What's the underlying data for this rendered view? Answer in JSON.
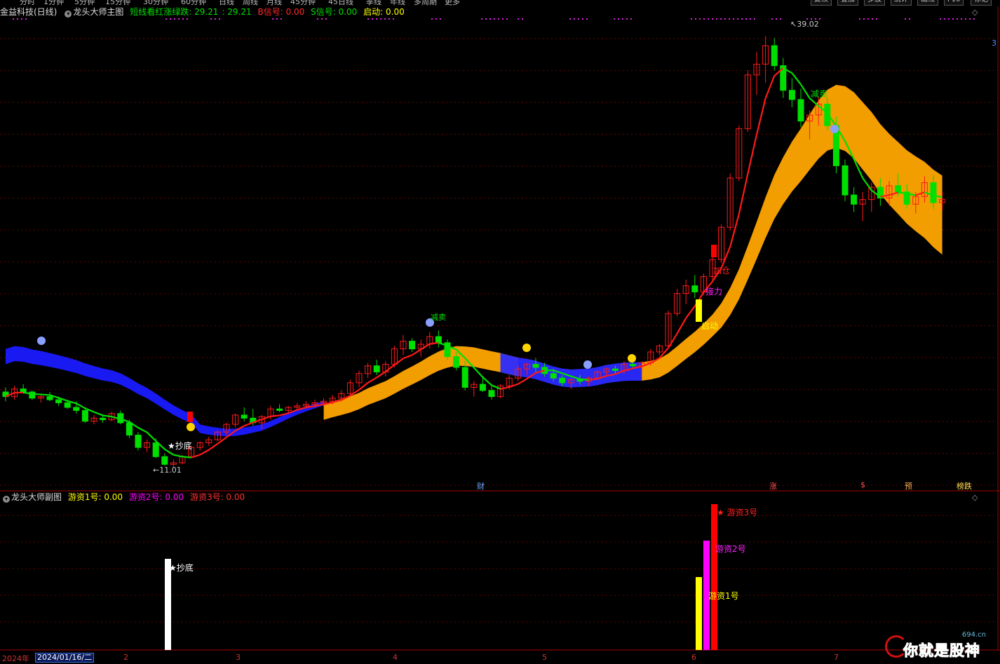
{
  "toolbar": {
    "periods": [
      "分时",
      "1分钟",
      "5分钟",
      "15分钟",
      "30分钟",
      "60分钟",
      "日线",
      "周线",
      "月线",
      "45分钟",
      "45日线",
      "季线",
      "年线",
      "多周期",
      "更多"
    ],
    "buttons": [
      "复权",
      "叠加",
      "多股",
      "统计",
      "画线",
      "F10",
      "标记"
    ]
  },
  "main_title": {
    "stock": "金益科技(日线)",
    "indicator": "龙头大师主图",
    "short_label": "短线看红涨绿跌: 29.21",
    "short_value2": ": 29.21",
    "b_signal": "B信号: 0.00",
    "s_signal": "S信号: 0.00",
    "start": "启动: 0.00"
  },
  "sub_title": {
    "indicator": "龙头大师副图",
    "f1": "游资1号: 0.00",
    "f2": "游资2号: 0.00",
    "f3": "游资3号: 0.00"
  },
  "price_annotations": {
    "high": "39.02",
    "low": "11.01",
    "chaodi": "★抄底",
    "jiemai": "减卖",
    "jiacang": "加仓",
    "jieli": "接力",
    "qidong": "启动",
    "mai": "减卖"
  },
  "sub_annotations": {
    "chaodi": "★抄底",
    "y1": "游资1号",
    "y2": "游资2号",
    "y3": "★ 游资3号"
  },
  "event_tags": [
    "财",
    "涨",
    "$",
    "预",
    "榜跌"
  ],
  "x_axis": {
    "year": "2024年",
    "date": "2024/01/16/二",
    "months": [
      "2",
      "3",
      "4",
      "5",
      "6",
      "7"
    ]
  },
  "right_marker": "3",
  "watermark": {
    "text": "你就是股神",
    "url": "694.cn"
  },
  "colors": {
    "up": "#ff1a1a",
    "down": "#00e000",
    "ma": "#ff1a1a",
    "ma_down": "#00e000",
    "band_blue": "#1a1aff",
    "band_orange": "#ffa500"
  },
  "chart_data": {
    "type": "candlestick",
    "y_range_main": [
      11.01,
      39.02
    ],
    "ohlc": [
      [
        15.9,
        16.2,
        15.3,
        15.6
      ],
      [
        15.6,
        16.3,
        15.4,
        16.1
      ],
      [
        16.1,
        16.4,
        15.8,
        15.9
      ],
      [
        15.9,
        16.0,
        15.4,
        15.5
      ],
      [
        15.5,
        15.8,
        15.2,
        15.6
      ],
      [
        15.6,
        15.9,
        15.3,
        15.4
      ],
      [
        15.4,
        15.6,
        15.0,
        15.2
      ],
      [
        15.2,
        15.4,
        14.8,
        14.9
      ],
      [
        14.9,
        15.3,
        14.5,
        14.7
      ],
      [
        14.7,
        14.9,
        13.9,
        14.0
      ],
      [
        14.0,
        14.4,
        13.8,
        14.2
      ],
      [
        14.2,
        14.4,
        13.9,
        14.1
      ],
      [
        14.1,
        14.6,
        14.0,
        14.5
      ],
      [
        14.5,
        14.7,
        13.8,
        13.9
      ],
      [
        13.9,
        14.1,
        12.9,
        13.1
      ],
      [
        13.1,
        13.3,
        12.1,
        12.3
      ],
      [
        12.3,
        12.8,
        12.0,
        12.6
      ],
      [
        12.6,
        12.9,
        11.6,
        11.7
      ],
      [
        11.7,
        11.9,
        11.1,
        11.2
      ],
      [
        11.2,
        11.5,
        11.01,
        11.3
      ],
      [
        11.3,
        11.8,
        11.2,
        11.7
      ],
      [
        11.7,
        12.4,
        11.6,
        12.3
      ],
      [
        12.3,
        12.7,
        12.1,
        12.6
      ],
      [
        12.6,
        13.0,
        12.4,
        12.8
      ],
      [
        12.8,
        13.4,
        12.7,
        13.3
      ],
      [
        13.3,
        13.9,
        13.1,
        13.8
      ],
      [
        13.8,
        14.5,
        13.6,
        14.4
      ],
      [
        14.4,
        14.9,
        14.0,
        14.2
      ],
      [
        14.2,
        14.8,
        13.7,
        13.9
      ],
      [
        13.9,
        14.4,
        13.5,
        14.3
      ],
      [
        14.3,
        15.0,
        14.1,
        14.8
      ],
      [
        14.8,
        15.1,
        14.6,
        14.7
      ],
      [
        14.7,
        15.0,
        14.5,
        14.9
      ],
      [
        14.9,
        15.2,
        14.7,
        15.0
      ],
      [
        15.0,
        15.3,
        14.8,
        15.1
      ],
      [
        15.1,
        15.4,
        14.9,
        15.2
      ],
      [
        15.2,
        15.5,
        15.0,
        15.3
      ],
      [
        15.3,
        15.7,
        15.1,
        15.5
      ],
      [
        15.5,
        16.0,
        15.3,
        15.8
      ],
      [
        15.8,
        16.7,
        15.6,
        16.5
      ],
      [
        16.5,
        17.3,
        16.2,
        17.1
      ],
      [
        17.1,
        17.8,
        16.8,
        17.6
      ],
      [
        17.6,
        18.0,
        17.0,
        17.2
      ],
      [
        17.2,
        17.9,
        16.9,
        17.7
      ],
      [
        17.7,
        18.9,
        17.5,
        18.7
      ],
      [
        18.7,
        19.6,
        18.3,
        19.2
      ],
      [
        19.2,
        19.4,
        18.5,
        18.7
      ],
      [
        18.7,
        19.3,
        18.2,
        19.0
      ],
      [
        19.0,
        19.8,
        18.7,
        19.5
      ],
      [
        19.5,
        19.9,
        18.8,
        19.1
      ],
      [
        19.1,
        19.3,
        18.0,
        18.2
      ],
      [
        18.2,
        18.5,
        17.3,
        17.5
      ],
      [
        17.5,
        17.9,
        16.0,
        16.2
      ],
      [
        16.2,
        16.6,
        15.6,
        16.4
      ],
      [
        16.4,
        16.9,
        15.9,
        16.0
      ],
      [
        16.0,
        16.3,
        15.4,
        15.6
      ],
      [
        15.6,
        16.4,
        15.5,
        16.3
      ],
      [
        16.3,
        17.0,
        16.1,
        16.8
      ],
      [
        16.8,
        17.6,
        16.6,
        17.4
      ],
      [
        17.4,
        17.8,
        17.0,
        17.7
      ],
      [
        17.7,
        18.1,
        17.2,
        17.5
      ],
      [
        17.5,
        17.8,
        16.9,
        17.1
      ],
      [
        17.1,
        17.4,
        16.6,
        16.8
      ],
      [
        16.8,
        17.0,
        16.3,
        16.5
      ],
      [
        16.5,
        16.8,
        16.1,
        16.7
      ],
      [
        16.7,
        17.0,
        16.4,
        16.6
      ],
      [
        16.6,
        16.9,
        16.3,
        16.8
      ],
      [
        16.8,
        17.3,
        16.7,
        17.2
      ],
      [
        17.2,
        17.5,
        16.9,
        17.4
      ],
      [
        17.4,
        17.6,
        17.1,
        17.3
      ],
      [
        17.3,
        17.9,
        17.1,
        17.7
      ],
      [
        17.7,
        18.1,
        17.4,
        17.6
      ],
      [
        17.6,
        17.9,
        17.3,
        17.8
      ],
      [
        17.8,
        18.7,
        17.6,
        18.5
      ],
      [
        18.5,
        19.0,
        18.3,
        18.9
      ],
      [
        18.9,
        21.2,
        18.8,
        21.0
      ],
      [
        21.0,
        22.6,
        20.8,
        22.3
      ],
      [
        22.3,
        23.2,
        21.6,
        22.8
      ],
      [
        22.8,
        23.5,
        22.0,
        22.4
      ],
      [
        22.4,
        23.6,
        22.2,
        23.4
      ],
      [
        23.4,
        24.8,
        23.1,
        24.5
      ],
      [
        24.5,
        26.8,
        24.3,
        26.6
      ],
      [
        26.6,
        30.1,
        26.4,
        29.8
      ],
      [
        29.8,
        33.2,
        29.6,
        33.0
      ],
      [
        33.0,
        36.8,
        32.8,
        36.5
      ],
      [
        36.5,
        38.0,
        35.2,
        37.2
      ],
      [
        37.2,
        39.02,
        36.0,
        38.4
      ],
      [
        38.4,
        38.9,
        36.8,
        37.1
      ],
      [
        37.1,
        37.6,
        35.0,
        35.5
      ],
      [
        35.5,
        36.3,
        34.4,
        34.9
      ],
      [
        34.9,
        35.6,
        33.1,
        33.5
      ],
      [
        33.5,
        34.2,
        32.3,
        33.9
      ],
      [
        33.9,
        35.1,
        33.2,
        34.6
      ],
      [
        34.6,
        35.0,
        32.9,
        33.2
      ],
      [
        33.2,
        33.8,
        30.1,
        30.6
      ],
      [
        30.6,
        31.0,
        28.3,
        28.7
      ],
      [
        28.7,
        29.2,
        27.6,
        28.1
      ],
      [
        28.1,
        28.9,
        27.0,
        28.4
      ],
      [
        28.4,
        29.5,
        27.6,
        29.2
      ],
      [
        29.2,
        29.8,
        28.0,
        28.5
      ],
      [
        28.5,
        29.6,
        28.0,
        29.3
      ],
      [
        29.3,
        30.1,
        28.6,
        28.9
      ],
      [
        28.9,
        29.4,
        27.8,
        28.1
      ],
      [
        28.1,
        28.9,
        27.5,
        28.6
      ],
      [
        28.6,
        29.9,
        28.2,
        29.5
      ],
      [
        29.5,
        30.0,
        27.8,
        28.2
      ],
      [
        28.2,
        28.9,
        27.7,
        28.4
      ]
    ],
    "sub_bars": [
      {
        "index": 19,
        "name": "抄底",
        "value": 1.0,
        "color": "#ffffff"
      },
      {
        "index": 76,
        "name": "游资1号",
        "value": 0.8,
        "color": "#ffff00"
      },
      {
        "index": 77,
        "name": "游资2号",
        "value": 1.2,
        "color": "#ff00ff"
      },
      {
        "index": 78,
        "name": "游资3号",
        "value": 1.6,
        "color": "#ff0000"
      }
    ]
  }
}
